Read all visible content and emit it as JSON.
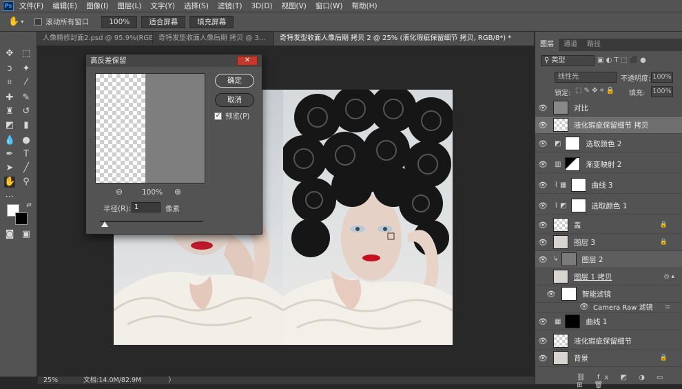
{
  "menubar": {
    "items": [
      "文件(F)",
      "编辑(E)",
      "图像(I)",
      "图层(L)",
      "文字(Y)",
      "选择(S)",
      "滤镜(T)",
      "3D(D)",
      "视图(V)",
      "窗口(W)",
      "帮助(H)"
    ]
  },
  "options": {
    "scroll_all_label": "滚动所有窗口",
    "zoom_value": "100%",
    "fit_screen": "适合屏幕",
    "fill_screen": "填充屏幕"
  },
  "tabs": [
    {
      "label": "人像精修封面2.psd @ 95.9%(RGB..."
    },
    {
      "label": "奇特发型收面人像后期 拷贝 @ 3..."
    },
    {
      "label": "奇特发型收面人像后期 拷贝 2 @ 25% (液化瑕疵保留细节 拷贝, RGB/8*) *"
    }
  ],
  "dialog": {
    "title": "高反差保留",
    "close": "✕",
    "ok": "确定",
    "cancel": "取消",
    "preview_label": "预览(P)",
    "zoom": "100%",
    "radius_label": "半径(R):",
    "radius_value": "1",
    "unit": "像素"
  },
  "panel": {
    "tabs": [
      "图层",
      "通道",
      "路径"
    ],
    "filter_kind": "类型",
    "blend_mode": "线性光",
    "opacity_label": "不透明度:",
    "opacity_value": "100%",
    "lock_label": "锁定:",
    "fill_label": "填充:",
    "fill_value": "100%"
  },
  "layers": [
    {
      "name": "对比"
    },
    {
      "name": "液化瑕疵保留细节 拷贝"
    },
    {
      "name": "选取颜色 2"
    },
    {
      "name": "渐变映射 2"
    },
    {
      "name": "曲线 3"
    },
    {
      "name": "选取颜色 1"
    },
    {
      "name": "盖"
    },
    {
      "name": "图层 3"
    },
    {
      "name": "图层 2"
    },
    {
      "name": "图层 1 拷贝"
    },
    {
      "name": "智能滤镜"
    },
    {
      "name": "Camera Raw 滤镜"
    },
    {
      "name": "曲线 1"
    },
    {
      "name": "液化瑕疵保留细节"
    },
    {
      "name": "背景"
    }
  ],
  "status": {
    "zoom": "25%",
    "doc_info": "文档:14.0M/82.9M"
  },
  "watermark": "虎课网"
}
